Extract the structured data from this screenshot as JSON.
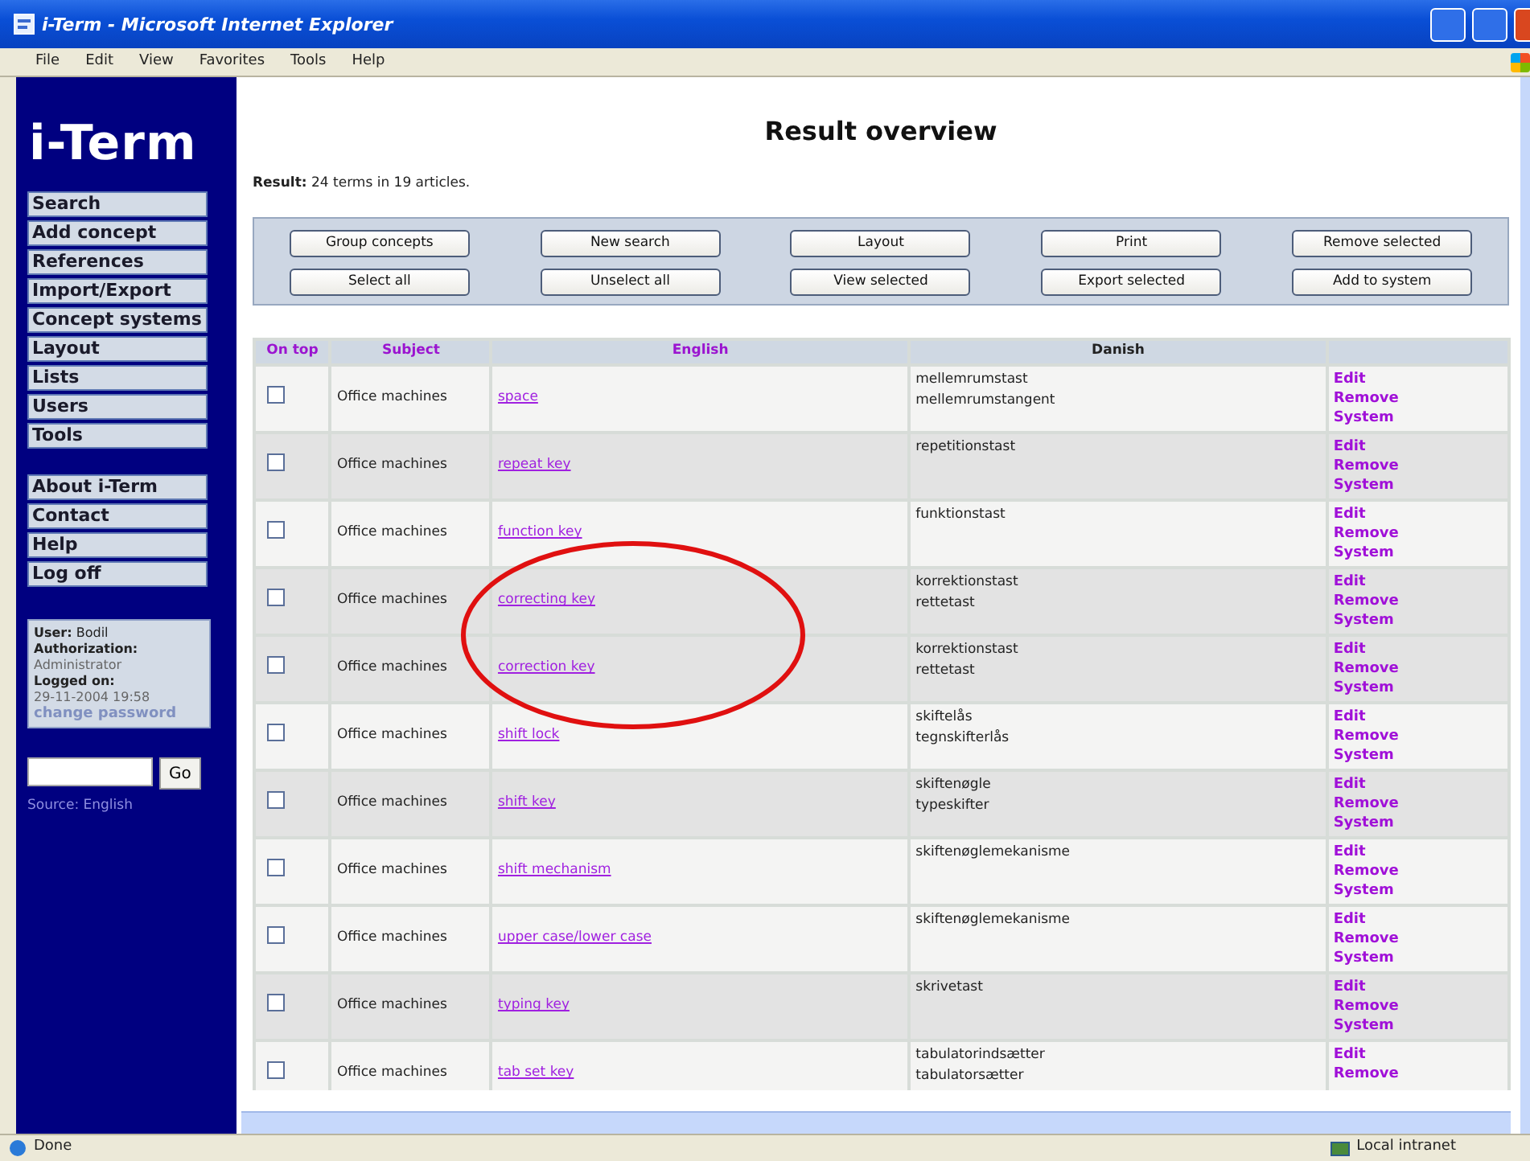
{
  "window": {
    "title": "i-Term - Microsoft Internet Explorer"
  },
  "menu": [
    "File",
    "Edit",
    "View",
    "Favorites",
    "Tools",
    "Help"
  ],
  "sidebar": {
    "logo": "i-Term",
    "nav_groups": [
      [
        "Search",
        "Add concept",
        "References",
        "Import/Export",
        "Concept systems",
        "Layout",
        "Lists",
        "Users",
        "Tools"
      ],
      [
        "About i-Term",
        "Contact",
        "Help",
        "Log off"
      ]
    ],
    "user_box": [
      {
        "kind": "text",
        "text": "**User:** Bodil"
      },
      {
        "kind": "label",
        "text": "Authorization:"
      },
      {
        "kind": "value",
        "text": "Administrator"
      },
      {
        "kind": "label",
        "text": "Logged on:"
      },
      {
        "kind": "value",
        "text": "29-11-2004 19:58"
      },
      {
        "kind": "link",
        "text": "change password"
      }
    ],
    "search": {
      "button": "Go"
    },
    "source": "Source: English"
  },
  "page": {
    "title": "Result overview",
    "result": "**Result:** 24 terms in 19 articles.",
    "buttons": [
      [
        "Group concepts",
        "New search",
        "Layout",
        "Print",
        "Remove selected"
      ],
      [
        "Select all",
        "Unselect all",
        "View selected",
        "Export selected",
        "Add to system"
      ]
    ]
  },
  "table": {
    "columns": [
      "On top",
      "Subject",
      "English",
      "Danish"
    ],
    "rows": [
      {
        "checked": false,
        "shaded": false,
        "circled": false,
        "subject": "Office machines",
        "english": "space",
        "danish": [
          "mellemrumstast",
          "mellemrumstangent"
        ],
        "actions": [
          "Edit",
          "Remove",
          "System"
        ]
      },
      {
        "checked": false,
        "shaded": true,
        "circled": false,
        "subject": "Office machines",
        "english": "repeat key",
        "danish": [
          "repetitionstast"
        ],
        "actions": [
          "Edit",
          "Remove",
          "System"
        ]
      },
      {
        "checked": false,
        "shaded": false,
        "circled": false,
        "subject": "Office machines",
        "english": "function key",
        "danish": [
          "funktionstast"
        ],
        "actions": [
          "Edit",
          "Remove",
          "System"
        ]
      },
      {
        "checked": false,
        "shaded": true,
        "circled": true,
        "subject": "Office machines",
        "english": "correcting key",
        "danish": [
          "korrektionstast",
          "rettetast"
        ],
        "actions": [
          "Edit",
          "Remove",
          "System"
        ]
      },
      {
        "checked": false,
        "shaded": true,
        "circled": true,
        "subject": "Office machines",
        "english": "correction key",
        "danish": [
          "korrektionstast",
          "rettetast"
        ],
        "actions": [
          "Edit",
          "Remove",
          "System"
        ]
      },
      {
        "checked": false,
        "shaded": false,
        "circled": false,
        "subject": "Office machines",
        "english": "shift lock",
        "danish": [
          "skiftelås",
          "tegnskifterlås"
        ],
        "actions": [
          "Edit",
          "Remove",
          "System"
        ]
      },
      {
        "checked": false,
        "shaded": true,
        "circled": false,
        "subject": "Office machines",
        "english": "shift key",
        "danish": [
          "skiftenøgle",
          "typeskifter"
        ],
        "actions": [
          "Edit",
          "Remove",
          "System"
        ]
      },
      {
        "checked": false,
        "shaded": false,
        "circled": false,
        "subject": "Office machines",
        "english": "shift mechanism",
        "danish": [
          "skiftenøglemekanisme"
        ],
        "actions": [
          "Edit",
          "Remove",
          "System"
        ]
      },
      {
        "checked": false,
        "shaded": false,
        "circled": false,
        "subject": "Office machines",
        "english": "upper case/lower case",
        "danish": [
          "skiftenøglemekanisme"
        ],
        "actions": [
          "Edit",
          "Remove",
          "System"
        ]
      },
      {
        "checked": false,
        "shaded": true,
        "circled": false,
        "subject": "Office machines",
        "english": "typing key",
        "danish": [
          "skrivetast"
        ],
        "actions": [
          "Edit",
          "Remove",
          "System"
        ]
      },
      {
        "checked": false,
        "shaded": false,
        "circled": false,
        "subject": "Office machines",
        "english": "tab set key",
        "danish": [
          "tabulatorindsætter",
          "tabulatorsætter"
        ],
        "actions": [
          "Edit",
          "Remove"
        ]
      }
    ]
  },
  "status_bar": {
    "text": "Done",
    "zone": "Local intranet"
  }
}
